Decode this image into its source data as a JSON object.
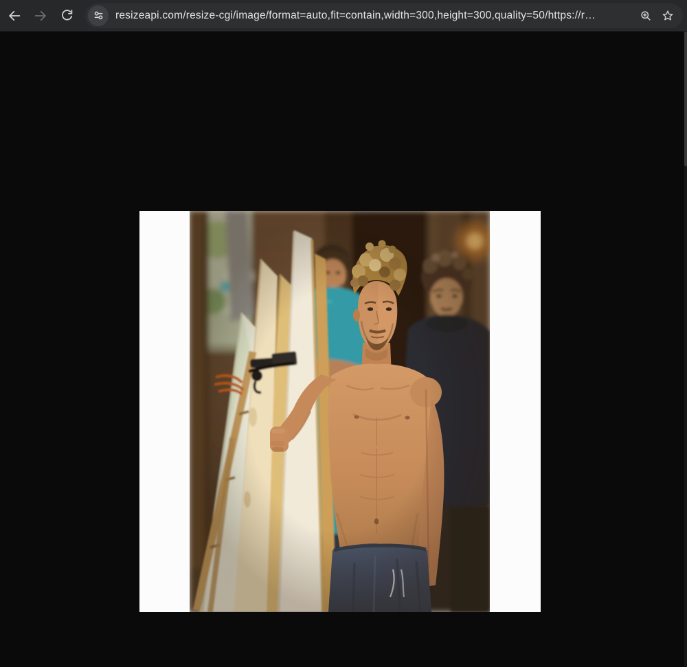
{
  "browser": {
    "toolbar": {
      "url": "resizeapi.com/resize-cgi/image/format=auto,fit=contain,width=300,height=300,quality=50/https://r…",
      "icons": {
        "back": "back-arrow",
        "forward": "forward-arrow",
        "reload": "reload-circular-arrow",
        "site_info": "tune-sliders",
        "zoom": "magnifier-plus",
        "bookmark": "star-outline"
      }
    }
  },
  "content": {
    "image_alt": "Shirtless muscular man with sandy curly hair and short beard standing beside a rack of cream, tan and white surfboards, gripping one board; behind him a man in a teal t-shirt with crossed arms and a man in a dark turtleneck; warm lantern glow and wooden storefront in the background; photo letterboxed with white bars on a black page"
  },
  "colors": {
    "toolbar_bg": "#262829",
    "omnibox_bg": "#2d2f31",
    "chip_bg": "#3e4043",
    "icon_color": "#d2d4d6",
    "icon_disabled_color": "#6c6f72",
    "url_text_color": "#e2e3e5",
    "page_bg": "#0a0a0a",
    "letterbox": "#fcfcfc"
  }
}
